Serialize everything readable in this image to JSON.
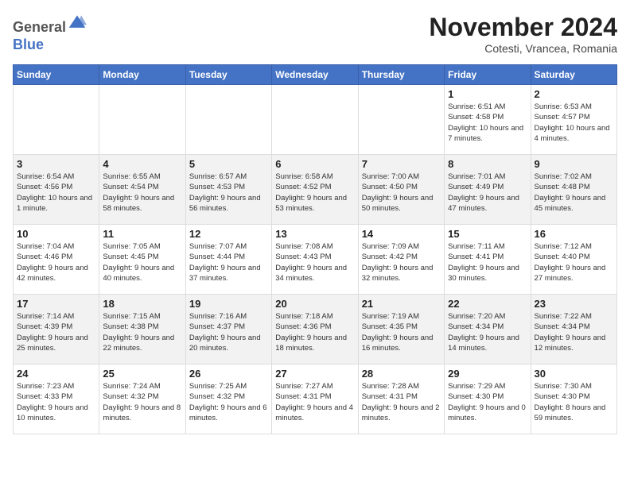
{
  "header": {
    "logo_general": "General",
    "logo_blue": "Blue",
    "month_title": "November 2024",
    "location": "Cotesti, Vrancea, Romania"
  },
  "weekdays": [
    "Sunday",
    "Monday",
    "Tuesday",
    "Wednesday",
    "Thursday",
    "Friday",
    "Saturday"
  ],
  "weeks": [
    [
      {
        "day": "",
        "info": ""
      },
      {
        "day": "",
        "info": ""
      },
      {
        "day": "",
        "info": ""
      },
      {
        "day": "",
        "info": ""
      },
      {
        "day": "",
        "info": ""
      },
      {
        "day": "1",
        "info": "Sunrise: 6:51 AM\nSunset: 4:58 PM\nDaylight: 10 hours and 7 minutes."
      },
      {
        "day": "2",
        "info": "Sunrise: 6:53 AM\nSunset: 4:57 PM\nDaylight: 10 hours and 4 minutes."
      }
    ],
    [
      {
        "day": "3",
        "info": "Sunrise: 6:54 AM\nSunset: 4:56 PM\nDaylight: 10 hours and 1 minute."
      },
      {
        "day": "4",
        "info": "Sunrise: 6:55 AM\nSunset: 4:54 PM\nDaylight: 9 hours and 58 minutes."
      },
      {
        "day": "5",
        "info": "Sunrise: 6:57 AM\nSunset: 4:53 PM\nDaylight: 9 hours and 56 minutes."
      },
      {
        "day": "6",
        "info": "Sunrise: 6:58 AM\nSunset: 4:52 PM\nDaylight: 9 hours and 53 minutes."
      },
      {
        "day": "7",
        "info": "Sunrise: 7:00 AM\nSunset: 4:50 PM\nDaylight: 9 hours and 50 minutes."
      },
      {
        "day": "8",
        "info": "Sunrise: 7:01 AM\nSunset: 4:49 PM\nDaylight: 9 hours and 47 minutes."
      },
      {
        "day": "9",
        "info": "Sunrise: 7:02 AM\nSunset: 4:48 PM\nDaylight: 9 hours and 45 minutes."
      }
    ],
    [
      {
        "day": "10",
        "info": "Sunrise: 7:04 AM\nSunset: 4:46 PM\nDaylight: 9 hours and 42 minutes."
      },
      {
        "day": "11",
        "info": "Sunrise: 7:05 AM\nSunset: 4:45 PM\nDaylight: 9 hours and 40 minutes."
      },
      {
        "day": "12",
        "info": "Sunrise: 7:07 AM\nSunset: 4:44 PM\nDaylight: 9 hours and 37 minutes."
      },
      {
        "day": "13",
        "info": "Sunrise: 7:08 AM\nSunset: 4:43 PM\nDaylight: 9 hours and 34 minutes."
      },
      {
        "day": "14",
        "info": "Sunrise: 7:09 AM\nSunset: 4:42 PM\nDaylight: 9 hours and 32 minutes."
      },
      {
        "day": "15",
        "info": "Sunrise: 7:11 AM\nSunset: 4:41 PM\nDaylight: 9 hours and 30 minutes."
      },
      {
        "day": "16",
        "info": "Sunrise: 7:12 AM\nSunset: 4:40 PM\nDaylight: 9 hours and 27 minutes."
      }
    ],
    [
      {
        "day": "17",
        "info": "Sunrise: 7:14 AM\nSunset: 4:39 PM\nDaylight: 9 hours and 25 minutes."
      },
      {
        "day": "18",
        "info": "Sunrise: 7:15 AM\nSunset: 4:38 PM\nDaylight: 9 hours and 22 minutes."
      },
      {
        "day": "19",
        "info": "Sunrise: 7:16 AM\nSunset: 4:37 PM\nDaylight: 9 hours and 20 minutes."
      },
      {
        "day": "20",
        "info": "Sunrise: 7:18 AM\nSunset: 4:36 PM\nDaylight: 9 hours and 18 minutes."
      },
      {
        "day": "21",
        "info": "Sunrise: 7:19 AM\nSunset: 4:35 PM\nDaylight: 9 hours and 16 minutes."
      },
      {
        "day": "22",
        "info": "Sunrise: 7:20 AM\nSunset: 4:34 PM\nDaylight: 9 hours and 14 minutes."
      },
      {
        "day": "23",
        "info": "Sunrise: 7:22 AM\nSunset: 4:34 PM\nDaylight: 9 hours and 12 minutes."
      }
    ],
    [
      {
        "day": "24",
        "info": "Sunrise: 7:23 AM\nSunset: 4:33 PM\nDaylight: 9 hours and 10 minutes."
      },
      {
        "day": "25",
        "info": "Sunrise: 7:24 AM\nSunset: 4:32 PM\nDaylight: 9 hours and 8 minutes."
      },
      {
        "day": "26",
        "info": "Sunrise: 7:25 AM\nSunset: 4:32 PM\nDaylight: 9 hours and 6 minutes."
      },
      {
        "day": "27",
        "info": "Sunrise: 7:27 AM\nSunset: 4:31 PM\nDaylight: 9 hours and 4 minutes."
      },
      {
        "day": "28",
        "info": "Sunrise: 7:28 AM\nSunset: 4:31 PM\nDaylight: 9 hours and 2 minutes."
      },
      {
        "day": "29",
        "info": "Sunrise: 7:29 AM\nSunset: 4:30 PM\nDaylight: 9 hours and 0 minutes."
      },
      {
        "day": "30",
        "info": "Sunrise: 7:30 AM\nSunset: 4:30 PM\nDaylight: 8 hours and 59 minutes."
      }
    ]
  ]
}
